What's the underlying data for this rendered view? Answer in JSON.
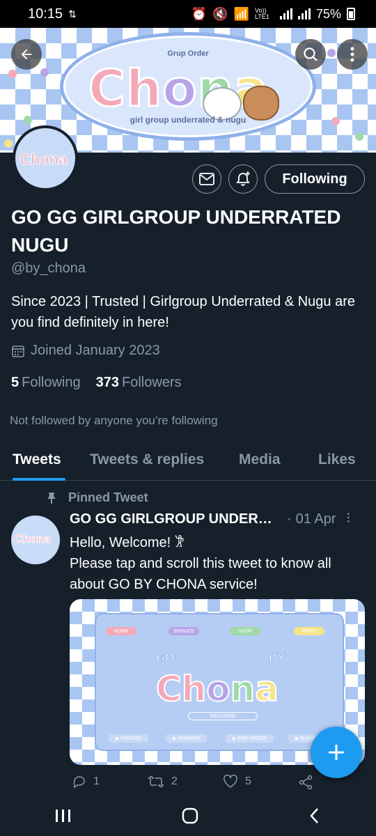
{
  "status_bar": {
    "time": "10:15",
    "network": "Vo)) LTE1",
    "battery": "75%"
  },
  "banner": {
    "tagline_top": "Grup Order",
    "logo_text": [
      "Ch",
      "o",
      "n",
      "a",
      ""
    ],
    "tagline_bottom": "girl group underrated & nugu"
  },
  "avatar": {
    "logo_text": "Chona"
  },
  "profile": {
    "follow_button": "Following",
    "display_name": "GO GG GIRLGROUP UNDERRATED NUGU",
    "handle": "@by_chona",
    "bio": "Since 2023 | Trusted | Girlgroup Underrated & Nugu are you find definitely in here!",
    "joined": "Joined January 2023",
    "following_count": "5",
    "following_label": "Following",
    "followers_count": "373",
    "followers_label": "Followers",
    "mutuals_note": "Not followed by anyone you’re following"
  },
  "tabs": [
    "Tweets",
    "Tweets & replies",
    "Media",
    "Likes"
  ],
  "tweet": {
    "pinned_label": "Pinned Tweet",
    "author": "GO GG GIRLGROUP UNDERRATED NUGU",
    "date": "01 Apr",
    "line1": "Hello, Welcome! 𐦂",
    "line2": "Please tap and scroll this tweet to know all about GO BY CHONA service!",
    "media": {
      "nav": [
        "HOME",
        "SERVICE",
        "SHOP",
        "MORE"
      ],
      "go": "GO",
      "by": "BY",
      "logo": [
        "Ch",
        "o",
        "n",
        "a",
        ""
      ],
      "welcome": "WELCOME!",
      "bottom": [
        "▶ PERSOD",
        "▶ SHARING",
        "▶ PRE ORDER",
        "▶ BUNJA"
      ]
    },
    "replies": "1",
    "retweets": "2",
    "likes": "5"
  },
  "colors": {
    "background": "#15202b",
    "accent": "#1d9bf0",
    "muted": "#8b98a5"
  }
}
